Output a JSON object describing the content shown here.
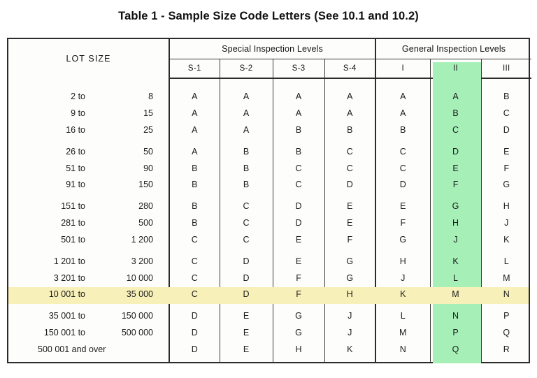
{
  "page": {
    "title": "Table 1 - Sample Size Code Letters (See 10.1 and 10.2)"
  },
  "table": {
    "lot_size_header": "LOT SIZE",
    "group_headers": [
      {
        "label": "Special Inspection Levels",
        "span": 4
      },
      {
        "label": "General Inspection Levels",
        "span": 3
      }
    ],
    "column_headers": [
      "S-1",
      "S-2",
      "S-3",
      "S-4",
      "I",
      "II",
      "III"
    ],
    "highlight": {
      "column_key": "II",
      "column_color": "#a6f0b8",
      "row_key": "10 001 to 35 000",
      "row_color": "#f8f0b9"
    },
    "rows": [
      {
        "from": "2 to",
        "to": "8",
        "group_start": true,
        "highlighted": false,
        "codes": [
          "A",
          "A",
          "A",
          "A",
          "A",
          "A",
          "B"
        ]
      },
      {
        "from": "9 to",
        "to": "15",
        "group_start": false,
        "highlighted": false,
        "codes": [
          "A",
          "A",
          "A",
          "A",
          "A",
          "B",
          "C"
        ]
      },
      {
        "from": "16 to",
        "to": "25",
        "group_start": false,
        "highlighted": false,
        "codes": [
          "A",
          "A",
          "B",
          "B",
          "B",
          "C",
          "D"
        ]
      },
      {
        "from": "26 to",
        "to": "50",
        "group_start": true,
        "highlighted": false,
        "codes": [
          "A",
          "B",
          "B",
          "C",
          "C",
          "D",
          "E"
        ]
      },
      {
        "from": "51 to",
        "to": "90",
        "group_start": false,
        "highlighted": false,
        "codes": [
          "B",
          "B",
          "C",
          "C",
          "C",
          "E",
          "F"
        ]
      },
      {
        "from": "91 to",
        "to": "150",
        "group_start": false,
        "highlighted": false,
        "codes": [
          "B",
          "B",
          "C",
          "D",
          "D",
          "F",
          "G"
        ]
      },
      {
        "from": "151 to",
        "to": "280",
        "group_start": true,
        "highlighted": false,
        "codes": [
          "B",
          "C",
          "D",
          "E",
          "E",
          "G",
          "H"
        ]
      },
      {
        "from": "281 to",
        "to": "500",
        "group_start": false,
        "highlighted": false,
        "codes": [
          "B",
          "C",
          "D",
          "E",
          "F",
          "H",
          "J"
        ]
      },
      {
        "from": "501 to",
        "to": "1 200",
        "group_start": false,
        "highlighted": false,
        "codes": [
          "C",
          "C",
          "E",
          "F",
          "G",
          "J",
          "K"
        ]
      },
      {
        "from": "1 201 to",
        "to": "3 200",
        "group_start": true,
        "highlighted": false,
        "codes": [
          "C",
          "D",
          "E",
          "G",
          "H",
          "K",
          "L"
        ]
      },
      {
        "from": "3 201 to",
        "to": "10 000",
        "group_start": false,
        "highlighted": false,
        "codes": [
          "C",
          "D",
          "F",
          "G",
          "J",
          "L",
          "M"
        ]
      },
      {
        "from": "10 001 to",
        "to": "35 000",
        "group_start": false,
        "highlighted": true,
        "codes": [
          "C",
          "D",
          "F",
          "H",
          "K",
          "M",
          "N"
        ]
      },
      {
        "from": "35 001 to",
        "to": "150 000",
        "group_start": true,
        "highlighted": false,
        "codes": [
          "D",
          "E",
          "G",
          "J",
          "L",
          "N",
          "P"
        ]
      },
      {
        "from": "150 001 to",
        "to": "500 000",
        "group_start": false,
        "highlighted": false,
        "codes": [
          "D",
          "E",
          "G",
          "J",
          "M",
          "P",
          "Q"
        ]
      },
      {
        "from": "500 001 and over",
        "to": "",
        "group_start": false,
        "highlighted": false,
        "span_label": true,
        "codes": [
          "D",
          "E",
          "H",
          "K",
          "N",
          "Q",
          "R"
        ]
      }
    ]
  }
}
